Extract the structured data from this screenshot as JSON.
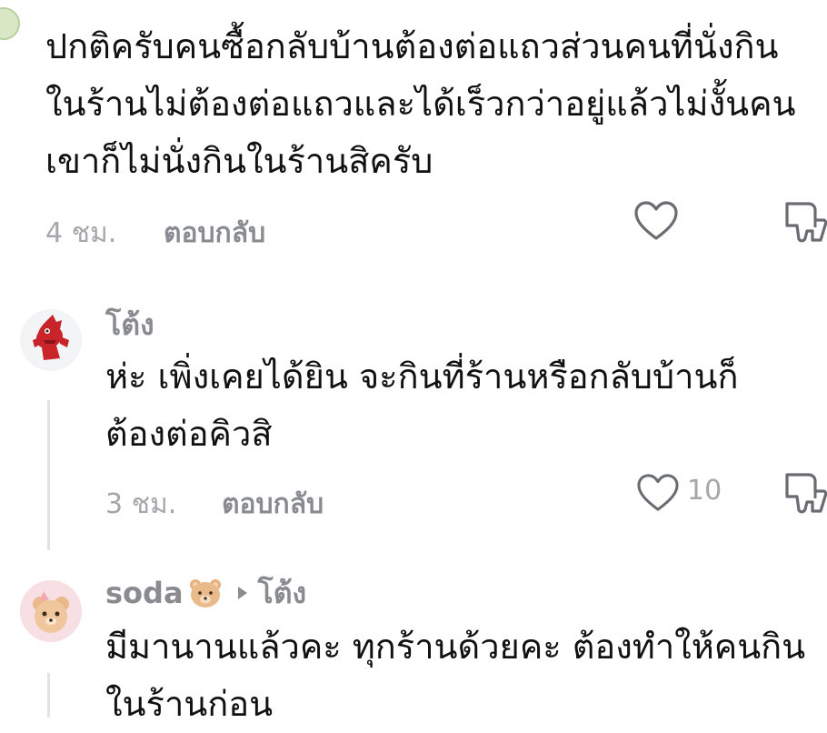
{
  "comments": [
    {
      "text": "ปกติครับคนซื้อกลับบ้านต้องต่อแถวส่วนคนที่นั่งกิน\nในร้านไม่ต้องต่อแถวและได้เร็วกว่าอยู่แล้วไม่งั้นคน\nเขาก็ไม่นั่งกินในร้านสิครับ",
      "time": "4 ชม.",
      "reply_label": "ตอบกลับ",
      "like_count": ""
    }
  ],
  "replies": [
    {
      "username": "โต้ง",
      "text": "ห่ะ เพิ่งเคยได้ยิน จะกินที่ร้านหรือกลับบ้านก็\nต้องต่อคิวสิ",
      "time": "3 ชม.",
      "reply_label": "ตอบกลับ",
      "like_count": "10"
    },
    {
      "username": "soda",
      "reply_to": "โต้ง",
      "text": "มีมานานแล้วคะ ทุกร้านด้วยคะ ต้องทำให้คนกิน\nในร้านก่อน"
    }
  ],
  "icons": {
    "like": "heart-outline-icon",
    "dislike": "thumbs-down-icon",
    "reply_arrow": "triangle-right-icon",
    "username_emoji": "bear-face-emoji"
  },
  "colors": {
    "text": "#111111",
    "muted": "#a6a6ab",
    "username": "#8a8b91",
    "thread_line": "#e3e3e6"
  }
}
